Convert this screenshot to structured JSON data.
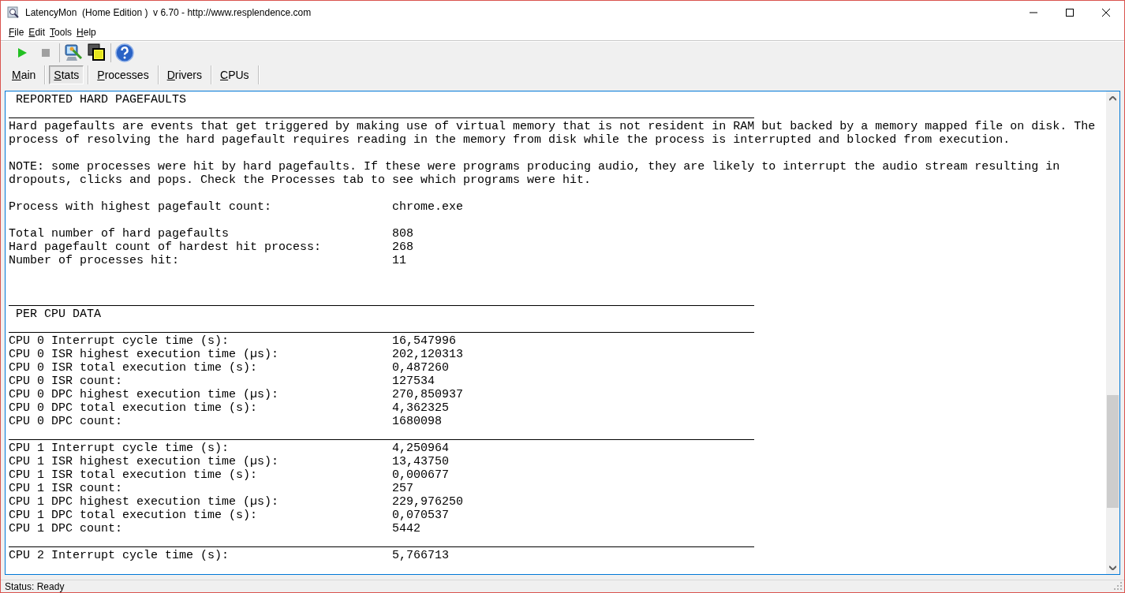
{
  "window": {
    "title": "LatencyMon  (Home Edition )  v 6.70 - http://www.resplendence.com"
  },
  "menu": [
    "File",
    "Edit",
    "Tools",
    "Help"
  ],
  "toolbar": {
    "groups": [
      [
        {
          "kind": "play",
          "disabled": false
        },
        {
          "kind": "stop",
          "disabled": true
        }
      ],
      [
        {
          "kind": "monitor",
          "disabled": false
        },
        {
          "kind": "windows",
          "disabled": false
        }
      ],
      [
        {
          "kind": "help",
          "disabled": false
        }
      ]
    ]
  },
  "tabs": [
    {
      "label": "Main",
      "selected": false
    },
    {
      "label": "Stats",
      "selected": true
    },
    {
      "label": "Processes",
      "selected": false
    },
    {
      "label": "Drivers",
      "selected": false
    },
    {
      "label": "CPUs",
      "selected": false
    }
  ],
  "report": [
    {
      "kind": "heading",
      "text": "REPORTED HARD PAGEFAULTS"
    },
    {
      "kind": "rule"
    },
    {
      "kind": "paragraph",
      "text": "Hard pagefaults are events that get triggered by making use of virtual memory that is not resident in RAM but backed by a memory mapped file on disk. The process of resolving the hard pagefault requires reading in the memory from disk while the process is interrupted and blocked from execution."
    },
    {
      "kind": "blank"
    },
    {
      "kind": "paragraph",
      "text": "NOTE: some processes were hit by hard pagefaults. If these were programs producing audio, they are likely to interrupt the audio stream resulting in dropouts, clicks and pops. Check the Processes tab to see which programs were hit."
    },
    {
      "kind": "blank"
    },
    {
      "kind": "row",
      "label": "Process with highest pagefault count:",
      "value": "chrome.exe"
    },
    {
      "kind": "blank"
    },
    {
      "kind": "row",
      "label": "Total number of hard pagefaults",
      "value": "808"
    },
    {
      "kind": "row",
      "label": "Hard pagefault count of hardest hit process:",
      "value": "268"
    },
    {
      "kind": "row",
      "label": "Number of processes hit:",
      "value": "11"
    },
    {
      "kind": "blank"
    },
    {
      "kind": "blank"
    },
    {
      "kind": "rule"
    },
    {
      "kind": "heading",
      "text": "PER CPU DATA"
    },
    {
      "kind": "rule"
    },
    {
      "kind": "row",
      "label": "CPU 0 Interrupt cycle time (s):",
      "value": "16,547996"
    },
    {
      "kind": "row",
      "label": "CPU 0 ISR highest execution time (µs):",
      "value": "202,120313"
    },
    {
      "kind": "row",
      "label": "CPU 0 ISR total execution time (s):",
      "value": "0,487260"
    },
    {
      "kind": "row",
      "label": "CPU 0 ISR count:",
      "value": "127534"
    },
    {
      "kind": "row",
      "label": "CPU 0 DPC highest execution time (µs):",
      "value": "270,850937"
    },
    {
      "kind": "row",
      "label": "CPU 0 DPC total execution time (s):",
      "value": "4,362325"
    },
    {
      "kind": "row",
      "label": "CPU 0 DPC count:",
      "value": "1680098"
    },
    {
      "kind": "rule"
    },
    {
      "kind": "row",
      "label": "CPU 1 Interrupt cycle time (s):",
      "value": "4,250964"
    },
    {
      "kind": "row",
      "label": "CPU 1 ISR highest execution time (µs):",
      "value": "13,43750"
    },
    {
      "kind": "row",
      "label": "CPU 1 ISR total execution time (s):",
      "value": "0,000677"
    },
    {
      "kind": "row",
      "label": "CPU 1 ISR count:",
      "value": "257"
    },
    {
      "kind": "row",
      "label": "CPU 1 DPC highest execution time (µs):",
      "value": "229,976250"
    },
    {
      "kind": "row",
      "label": "CPU 1 DPC total execution time (s):",
      "value": "0,070537"
    },
    {
      "kind": "row",
      "label": "CPU 1 DPC count:",
      "value": "5442"
    },
    {
      "kind": "rule"
    },
    {
      "kind": "row",
      "label": "CPU 2 Interrupt cycle time (s):",
      "value": "5,766713"
    }
  ],
  "status_bar": "Status: Ready"
}
